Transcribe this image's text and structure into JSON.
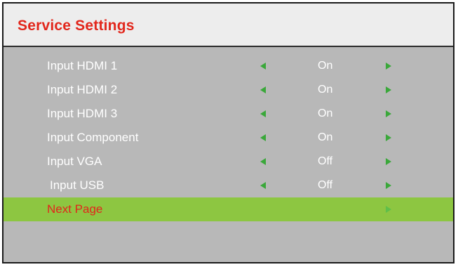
{
  "header": {
    "title": "Service Settings"
  },
  "menu": {
    "items": [
      {
        "label": "Input HDMI 1",
        "value": "On"
      },
      {
        "label": "Input HDMI 2",
        "value": "On"
      },
      {
        "label": "Input HDMI 3",
        "value": "On"
      },
      {
        "label": "Input Component",
        "value": "On"
      },
      {
        "label": "Input VGA",
        "value": "Off"
      },
      {
        "label": "Input USB",
        "value": "Off"
      }
    ],
    "next_page": {
      "label": "Next Page"
    }
  },
  "colors": {
    "title": "#e2261b",
    "panel_bg": "#b8b8b8",
    "header_bg": "#ededed",
    "selected_bg": "#8dc641",
    "arrow": "#3aa83a",
    "text": "#ffffff"
  }
}
